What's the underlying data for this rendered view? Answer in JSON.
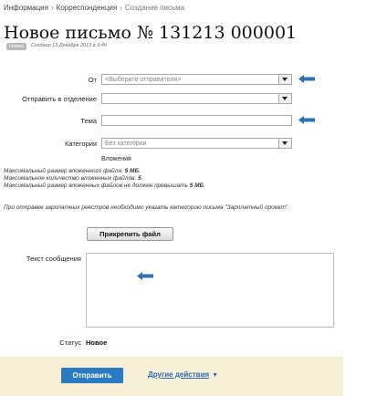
{
  "breadcrumbs": [
    "Информация",
    "Корреспонденция",
    "Создание письма"
  ],
  "breadcrumb_separator": "›",
  "title": "Новое письмо № 131213 000001",
  "status_badge": "Новое",
  "created_text": "Создано 13 Декабря 2013 в 9:49",
  "form": {
    "from": {
      "label": "От",
      "value": "<Выберите отправителя>"
    },
    "department": {
      "label": "Отправить в отделение",
      "value": ""
    },
    "subject": {
      "label": "Тема",
      "value": ""
    },
    "category": {
      "label": "Категория",
      "value": "Без категории"
    }
  },
  "attachments_title": "Вложения",
  "attachment_notes": [
    {
      "text": "Максимальный размер вложенного файла: ",
      "bold": "5 МБ",
      "end": "."
    },
    {
      "text": "Максимальное количество вложенных файлов: ",
      "bold": "5",
      "end": "."
    },
    {
      "text": "Максимальный размер вложенных файлов не должен превышать ",
      "bold": "5 МБ",
      "end": "."
    }
  ],
  "payroll_note": "При отправке зарплатных реестров необходимо указать категорию письма \"Зарплатный проект\".",
  "attach_button": "Прикрепить файл",
  "message_label": "Текст сообщения",
  "message_value": "",
  "status": {
    "label": "Статус",
    "value": "Новое"
  },
  "send_button": "Отправить",
  "other_actions": "Другие действия",
  "other_actions_icon": "triangle-down-icon",
  "colors": {
    "arrow": "#2f6fb3",
    "primary_button": "#2b7bc4",
    "footer_bg": "#f6f0d7",
    "link": "#2b6ab3"
  }
}
